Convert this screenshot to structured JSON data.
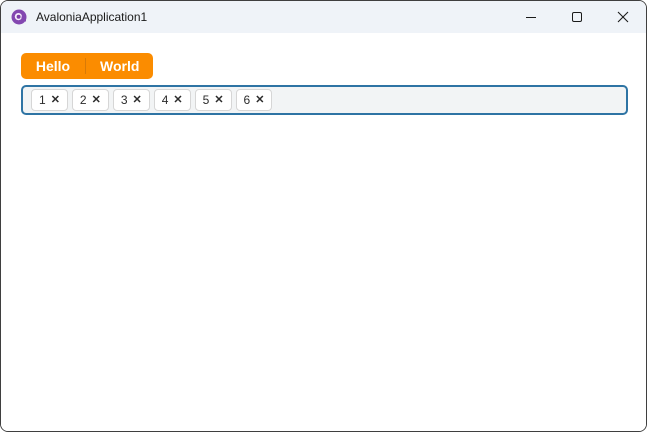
{
  "window": {
    "title": "AvaloniaApplication1",
    "icons": {
      "app": "avalonia-logo",
      "minimize": "thin horizontal dash",
      "maximize": "outlined square",
      "close": "diagonal cross"
    },
    "colors": {
      "titlebar_bg": "#eff3f8",
      "window_border": "#3f3f3f"
    }
  },
  "tabstrip": {
    "accent_color": "#fb8c00",
    "tabs": [
      {
        "label": "Hello"
      },
      {
        "label": "World"
      }
    ]
  },
  "chips": {
    "border_color": "#2e74a4",
    "close_glyph": "✕",
    "items": [
      {
        "label": "1"
      },
      {
        "label": "2"
      },
      {
        "label": "3"
      },
      {
        "label": "4"
      },
      {
        "label": "5"
      },
      {
        "label": "6"
      }
    ]
  }
}
